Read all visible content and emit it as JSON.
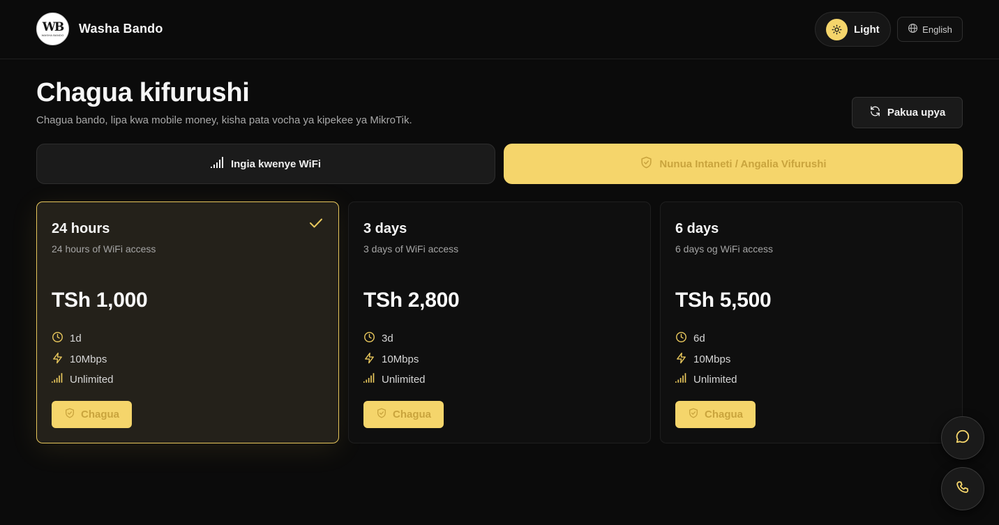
{
  "header": {
    "logo_text": "WB",
    "logo_subtext": "WASHA BANDO",
    "brand": "Washa Bando",
    "theme_label": "Light",
    "language_label": "English"
  },
  "main": {
    "title": "Chagua kifurushi",
    "subtitle": "Chagua bando, lipa kwa mobile money, kisha pata vocha ya kipekee ya MikroTik.",
    "refresh_label": "Pakua upya"
  },
  "tabs": [
    {
      "label": "Ingia kwenye WiFi",
      "icon": "signal-bars-icon",
      "active": false
    },
    {
      "label": "Nunua Intaneti / Angalia Vifurushi",
      "icon": "shield-check-icon",
      "active": true
    }
  ],
  "packages": [
    {
      "name": "24 hours",
      "description": "24 hours of WiFi access",
      "price": "TSh 1,000",
      "duration": "1d",
      "speed": "10Mbps",
      "data": "Unlimited",
      "button_label": "Chagua",
      "selected": true
    },
    {
      "name": "3 days",
      "description": "3 days of WiFi access",
      "price": "TSh 2,800",
      "duration": "3d",
      "speed": "10Mbps",
      "data": "Unlimited",
      "button_label": "Chagua",
      "selected": false
    },
    {
      "name": "6 days",
      "description": "6 days og WiFi access",
      "price": "TSh 5,500",
      "duration": "6d",
      "speed": "10Mbps",
      "data": "Unlimited",
      "button_label": "Chagua",
      "selected": false
    }
  ],
  "fab": {
    "chat_icon": "chat-bubble-icon",
    "phone_icon": "phone-icon"
  },
  "colors": {
    "background": "#0b0b0b",
    "accent": "#f5d56b",
    "selected_border": "#e8c75c"
  }
}
